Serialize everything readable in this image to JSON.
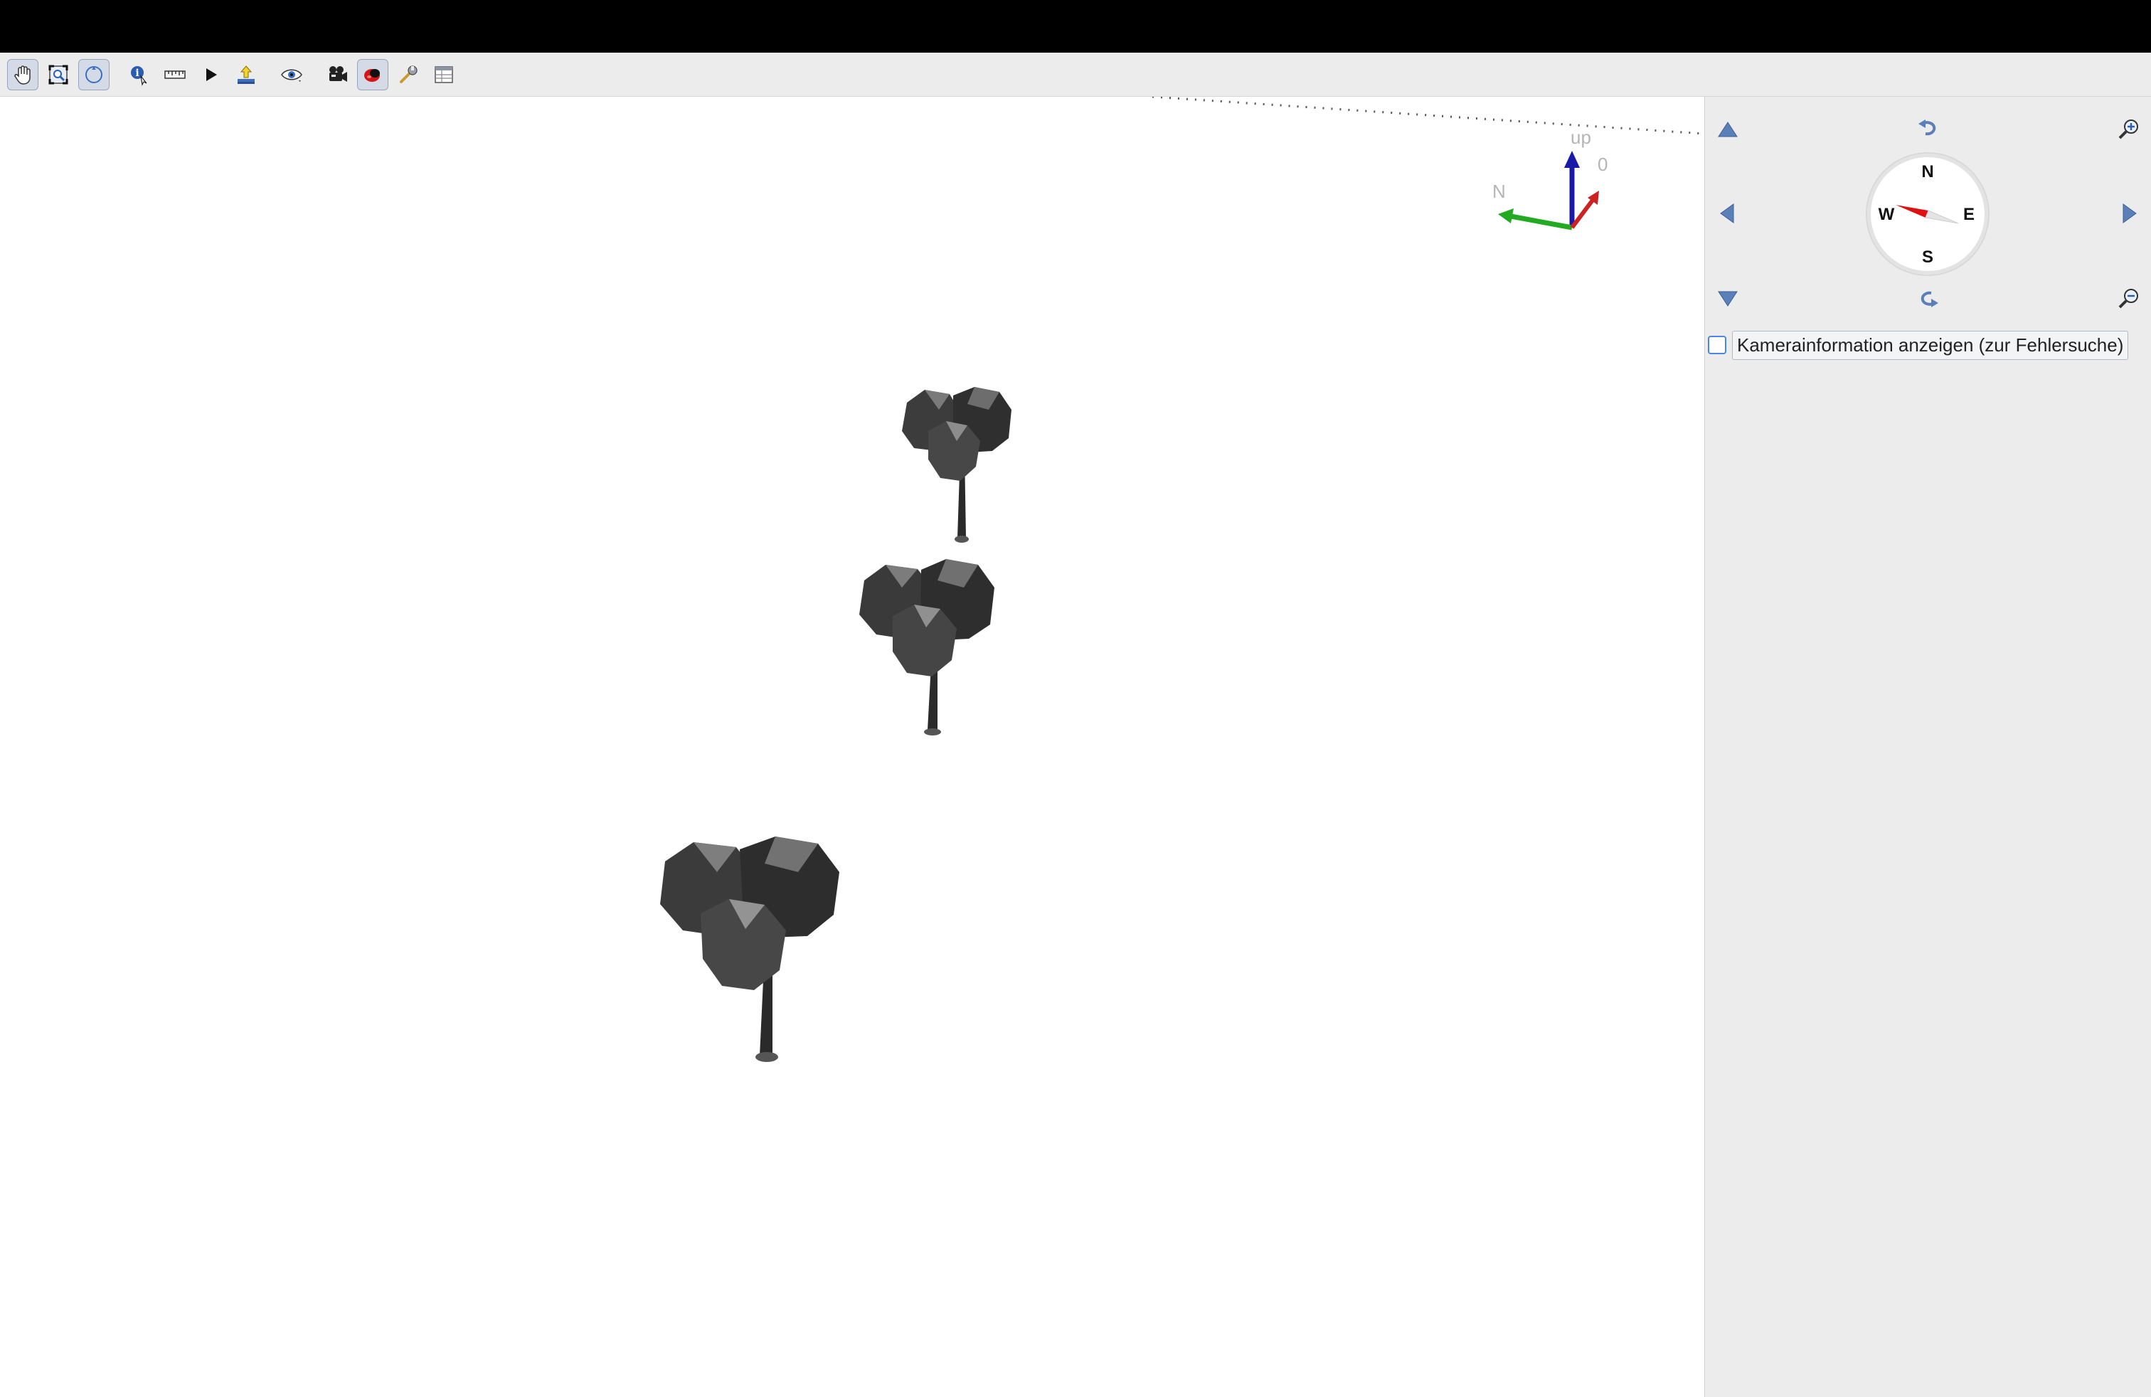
{
  "toolbar": {
    "items": [
      {
        "icon": "pan-hand-icon",
        "tooltip": ""
      },
      {
        "icon": "zoom-full-icon",
        "tooltip": ""
      },
      {
        "icon": "rotate-camera-icon",
        "tooltip": ""
      },
      {
        "icon": "identify-icon",
        "tooltip": ""
      },
      {
        "icon": "measure-ruler-icon",
        "tooltip": ""
      },
      {
        "icon": "animation-play-icon",
        "tooltip": ""
      },
      {
        "icon": "export-icon",
        "tooltip": ""
      },
      {
        "icon": "eye-icon",
        "tooltip": ""
      },
      {
        "icon": "camera-record-icon",
        "tooltip": ""
      },
      {
        "icon": "effects-icon",
        "tooltip": ""
      },
      {
        "icon": "wrench-icon",
        "tooltip": ""
      },
      {
        "icon": "layout-icon",
        "tooltip": ""
      }
    ]
  },
  "viewport": {
    "axis": {
      "up_label": "up",
      "north_label": "N",
      "zero_label": "0",
      "colors": {
        "up": "#1a1aa6",
        "north": "#22aa22",
        "east": "#cc2222"
      }
    },
    "objects": [
      "tree",
      "tree",
      "tree"
    ]
  },
  "navigation": {
    "compass": {
      "n": "N",
      "e": "E",
      "s": "S",
      "w": "W"
    },
    "camera_info_label": "Kamerainformation anzeigen (zur Fehlersuche)",
    "camera_info_checked": false
  },
  "colors": {
    "toolbar_bg": "#ececec",
    "viewport_bg": "#ffffff",
    "panel_bg": "#ececec",
    "nav_arrow": "#5b7fb8",
    "needle_red": "#dd1111"
  }
}
